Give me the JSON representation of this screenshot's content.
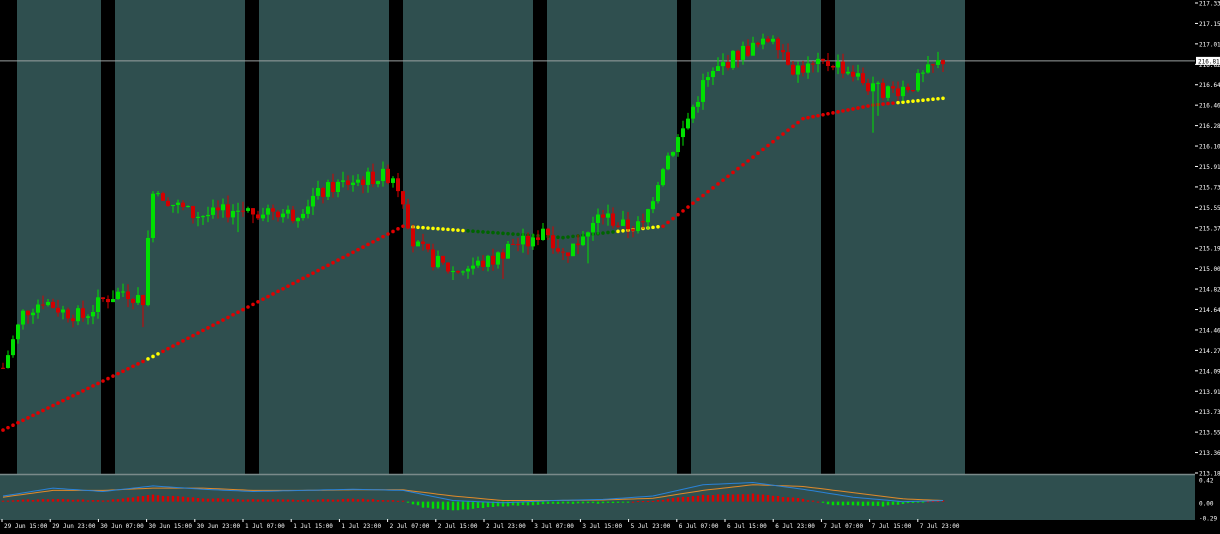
{
  "colors": {
    "background": "#000000",
    "band": "#2f4f4f",
    "axis_bg": "#000000",
    "text": "#ffffff",
    "candle_up": "#00e000",
    "candle_down": "#d40000",
    "sar_red": "#e00000",
    "sar_yellow": "#ffff00",
    "sar_green": "#006400",
    "price_line": "#9aa0a0",
    "macd_line": "#2a82d8",
    "signal_line": "#e08a2a",
    "hist_up": "#00e000",
    "hist_down": "#e00000"
  },
  "chart_data": [
    {
      "type": "candlestick",
      "panel": "main",
      "y_ticks": [
        "217.33",
        "217.15",
        "217.01",
        "216.82",
        "216.64",
        "216.46",
        "216.28",
        "216.10",
        "215.91",
        "215.73",
        "215.55",
        "215.37",
        "215.19",
        "215.00",
        "214.82",
        "214.64",
        "214.46",
        "214.27",
        "214.09",
        "213.91",
        "213.73",
        "213.55",
        "213.36",
        "213.18"
      ],
      "ylim": [
        213.18,
        217.33
      ],
      "current_price": "216.81",
      "x_labels": [
        "29 Jun 15:00",
        "29 Jun 23:00",
        "30 Jun 07:00",
        "30 Jun 15:00",
        "30 Jun 23:00",
        "1 Jul 07:00",
        "1 Jul 15:00",
        "1 Jul 23:00",
        "2 Jul 07:00",
        "2 Jul 15:00",
        "2 Jul 23:00",
        "3 Jul 07:00",
        "3 Jul 15:00",
        "5 Jul 23:00",
        "6 Jul 07:00",
        "6 Jul 15:00",
        "6 Jul 23:00",
        "7 Jul 07:00",
        "7 Jul 15:00",
        "7 Jul 23:00"
      ],
      "anchors": [
        [
          0,
          214.1
        ],
        [
          4,
          214.58
        ],
        [
          8,
          214.7
        ],
        [
          12,
          214.6
        ],
        [
          16,
          214.55
        ],
        [
          20,
          214.7
        ],
        [
          24,
          214.78
        ],
        [
          28,
          214.7
        ],
        [
          30,
          215.7
        ],
        [
          34,
          215.55
        ],
        [
          38,
          215.45
        ],
        [
          42,
          215.45
        ],
        [
          46,
          215.5
        ],
        [
          50,
          215.48
        ],
        [
          54,
          215.5
        ],
        [
          58,
          215.45
        ],
        [
          62,
          215.6
        ],
        [
          66,
          215.7
        ],
        [
          70,
          215.75
        ],
        [
          74,
          215.78
        ],
        [
          78,
          215.8
        ],
        [
          80,
          215.6
        ],
        [
          82,
          215.2
        ],
        [
          86,
          215.05
        ],
        [
          90,
          214.95
        ],
        [
          94,
          215.0
        ],
        [
          98,
          215.05
        ],
        [
          102,
          215.2
        ],
        [
          106,
          215.2
        ],
        [
          108,
          215.35
        ],
        [
          112,
          215.1
        ],
        [
          116,
          215.25
        ],
        [
          120,
          215.45
        ],
        [
          124,
          215.35
        ],
        [
          128,
          215.35
        ],
        [
          132,
          215.9
        ],
        [
          136,
          216.2
        ],
        [
          140,
          216.6
        ],
        [
          144,
          216.78
        ],
        [
          148,
          216.9
        ],
        [
          152,
          216.95
        ],
        [
          154,
          217.05
        ],
        [
          158,
          216.75
        ],
        [
          162,
          216.75
        ],
        [
          166,
          216.8
        ],
        [
          170,
          216.7
        ],
        [
          174,
          216.55
        ],
        [
          178,
          216.55
        ],
        [
          182,
          216.6
        ],
        [
          186,
          216.75
        ],
        [
          188,
          216.82
        ]
      ],
      "sar": [
        [
          0,
          213.55
        ],
        [
          30,
          214.2
        ],
        [
          80,
          215.35
        ],
        [
          96,
          215.3
        ],
        [
          112,
          215.25
        ],
        [
          132,
          215.35
        ],
        [
          160,
          216.3
        ],
        [
          174,
          216.42
        ],
        [
          188,
          216.48
        ]
      ],
      "sar_segments": [
        {
          "from": 0,
          "to": 28,
          "color": "red"
        },
        {
          "from": 29,
          "to": 31,
          "color": "yellow"
        },
        {
          "from": 32,
          "to": 80,
          "color": "red"
        },
        {
          "from": 81,
          "to": 92,
          "color": "yellow"
        },
        {
          "from": 93,
          "to": 122,
          "color": "green"
        },
        {
          "from": 123,
          "to": 131,
          "color": "yellow"
        },
        {
          "from": 132,
          "to": 178,
          "color": "red"
        },
        {
          "from": 179,
          "to": 188,
          "color": "yellow"
        }
      ]
    },
    {
      "type": "macd",
      "panel": "sub",
      "y_ticks": [
        "0.42",
        "0.00",
        "-0.29"
      ],
      "ylim": [
        -0.29,
        0.42
      ],
      "histogram_anchors": [
        [
          0,
          0.02
        ],
        [
          10,
          0.05
        ],
        [
          20,
          0.02
        ],
        [
          30,
          0.12
        ],
        [
          40,
          0.06
        ],
        [
          50,
          0.04
        ],
        [
          60,
          0.03
        ],
        [
          70,
          0.05
        ],
        [
          80,
          0.02
        ],
        [
          84,
          -0.1
        ],
        [
          90,
          -0.16
        ],
        [
          100,
          -0.08
        ],
        [
          110,
          -0.04
        ],
        [
          120,
          -0.03
        ],
        [
          130,
          0.02
        ],
        [
          140,
          0.12
        ],
        [
          150,
          0.14
        ],
        [
          160,
          0.05
        ],
        [
          166,
          -0.06
        ],
        [
          176,
          -0.08
        ],
        [
          182,
          -0.02
        ],
        [
          188,
          0.02
        ]
      ],
      "macd_anchors": [
        [
          0,
          0.1
        ],
        [
          10,
          0.24
        ],
        [
          20,
          0.18
        ],
        [
          30,
          0.28
        ],
        [
          40,
          0.22
        ],
        [
          50,
          0.18
        ],
        [
          60,
          0.2
        ],
        [
          70,
          0.22
        ],
        [
          80,
          0.2
        ],
        [
          90,
          0.02
        ],
        [
          100,
          -0.02
        ],
        [
          110,
          0.02
        ],
        [
          120,
          0.04
        ],
        [
          130,
          0.1
        ],
        [
          140,
          0.3
        ],
        [
          150,
          0.34
        ],
        [
          160,
          0.22
        ],
        [
          170,
          0.08
        ],
        [
          180,
          0.0
        ],
        [
          188,
          0.02
        ]
      ],
      "signal_anchors": [
        [
          0,
          0.08
        ],
        [
          10,
          0.2
        ],
        [
          20,
          0.2
        ],
        [
          30,
          0.24
        ],
        [
          40,
          0.24
        ],
        [
          50,
          0.2
        ],
        [
          60,
          0.2
        ],
        [
          70,
          0.21
        ],
        [
          80,
          0.21
        ],
        [
          90,
          0.1
        ],
        [
          100,
          0.02
        ],
        [
          110,
          0.02
        ],
        [
          120,
          0.03
        ],
        [
          130,
          0.06
        ],
        [
          140,
          0.2
        ],
        [
          150,
          0.3
        ],
        [
          160,
          0.27
        ],
        [
          170,
          0.16
        ],
        [
          180,
          0.05
        ],
        [
          188,
          0.02
        ]
      ]
    }
  ]
}
